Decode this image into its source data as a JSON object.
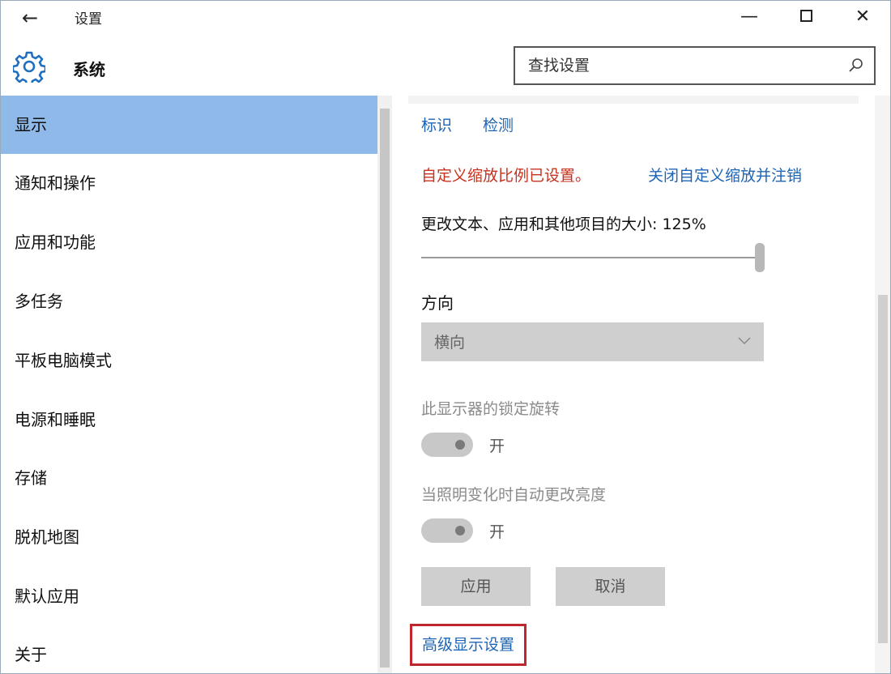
{
  "window": {
    "title": "设置",
    "back_glyph": "←",
    "minimize_glyph": "—",
    "close_glyph": "✕"
  },
  "header": {
    "icon": "gear-icon",
    "title": "系统",
    "search_placeholder": "查找设置",
    "search_icon": "search-icon"
  },
  "sidebar": {
    "items": [
      {
        "label": "显示",
        "active": true
      },
      {
        "label": "通知和操作"
      },
      {
        "label": "应用和功能"
      },
      {
        "label": "多任务"
      },
      {
        "label": "平板电脑模式"
      },
      {
        "label": "电源和睡眠"
      },
      {
        "label": "存储"
      },
      {
        "label": "脱机地图"
      },
      {
        "label": "默认应用"
      },
      {
        "label": "关于"
      }
    ]
  },
  "content": {
    "identify_link": "标识",
    "detect_link": "检测",
    "custom_scale_warning": "自定义缩放比例已设置。",
    "reset_scale_link": "关闭自定义缩放并注销",
    "scale_label": "更改文本、应用和其他项目的大小: 125%",
    "scale_slider_value": 1.0,
    "orientation_label": "方向",
    "orientation_value": "横向",
    "rotation_lock_label": "此显示器的锁定旋转",
    "rotation_lock_state": "开",
    "auto_brightness_label": "当照明变化时自动更改亮度",
    "auto_brightness_state": "开",
    "apply_button": "应用",
    "cancel_button": "取消",
    "advanced_link": "高级显示设置"
  },
  "colors": {
    "active_nav": "#8fb9e8",
    "link": "#1e64b4",
    "warning": "#c8321e",
    "highlight_border": "#c0262d"
  }
}
